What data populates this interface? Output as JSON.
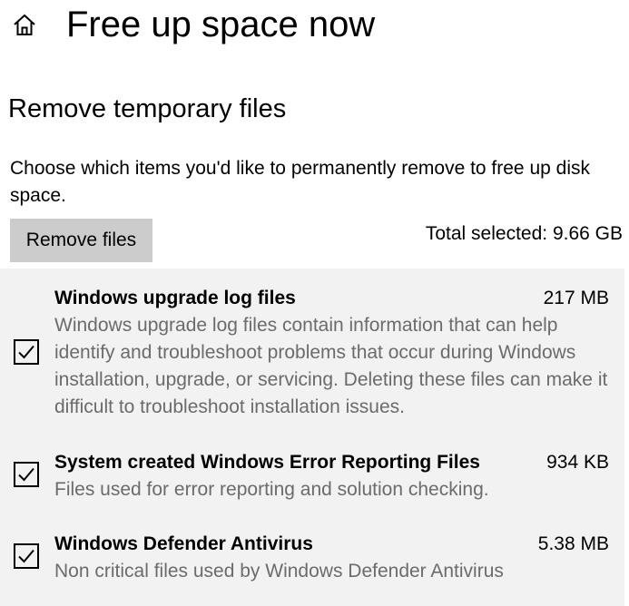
{
  "header": {
    "title": "Free up space now"
  },
  "section": {
    "title": "Remove temporary files",
    "description": "Choose which items you'd like to permanently remove to free up disk space."
  },
  "actions": {
    "remove_label": "Remove files",
    "total_selected": "Total selected: 9.66 GB"
  },
  "items": [
    {
      "name": "Windows upgrade log files",
      "size": "217 MB",
      "description": "Windows upgrade log files contain information that can help identify and troubleshoot problems that occur during Windows installation, upgrade, or servicing.  Deleting these files can make it difficult to troubleshoot installation issues.",
      "checked": true
    },
    {
      "name": "System created Windows Error Reporting Files",
      "size": "934 KB",
      "description": "Files used for error reporting and solution checking.",
      "checked": true
    },
    {
      "name": "Windows Defender Antivirus",
      "size": "5.38 MB",
      "description": "Non critical files used by Windows Defender Antivirus",
      "checked": true
    }
  ]
}
